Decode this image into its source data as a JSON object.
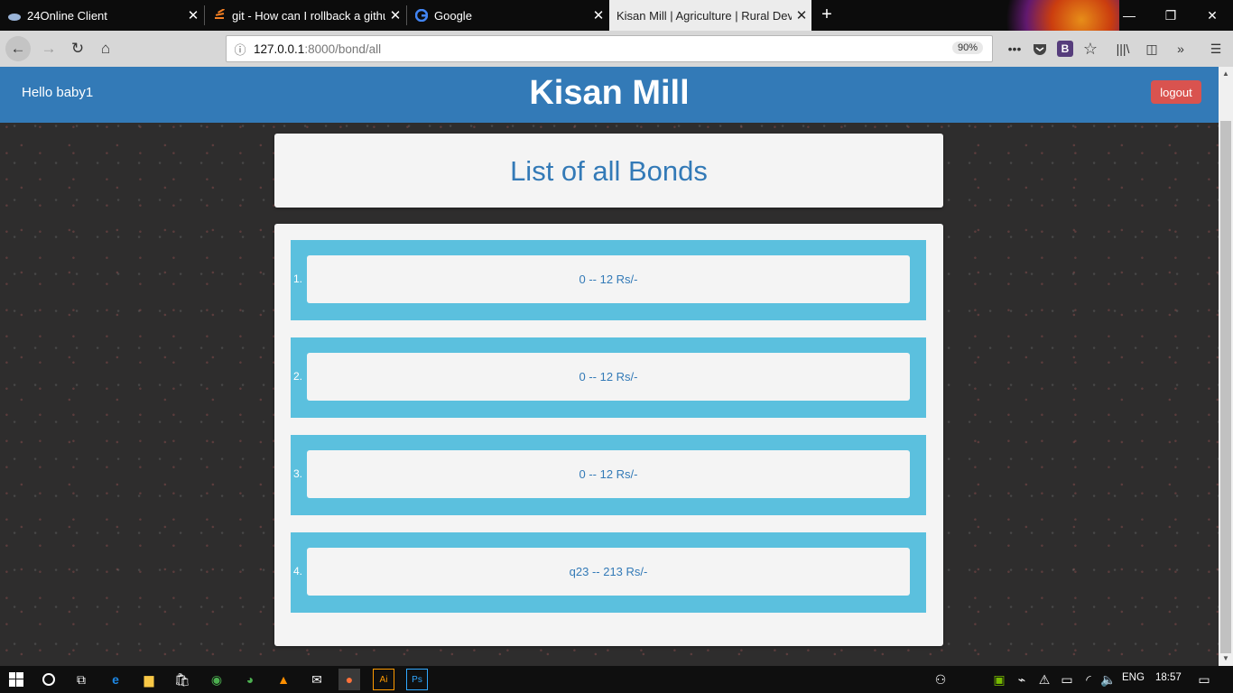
{
  "browser": {
    "tabs": [
      {
        "title": "24Online Client",
        "icon": "cloud-icon"
      },
      {
        "title": "git - How can I rollback a github",
        "icon": "stack-overflow-icon"
      },
      {
        "title": "Google",
        "icon": "google-icon"
      },
      {
        "title": "Kisan Mill | Agriculture | Rural Development",
        "icon": "",
        "active": true
      }
    ],
    "url_host": "127.0.0.1",
    "url_path": ":8000/bond/all",
    "zoom": "90%",
    "toolbar_icons": [
      "more-icon",
      "pocket-icon",
      "bootstrap-extension-icon",
      "bookmark-star-icon",
      "library-icon",
      "sidebar-icon",
      "overflow-icon",
      "menu-icon"
    ]
  },
  "site": {
    "greeting": "Hello baby1",
    "brand": "Kisan Mill",
    "logout_label": "logout",
    "header_color": "#337ab7"
  },
  "page": {
    "title": "List of all Bonds",
    "bonds": [
      {
        "number": "1.",
        "text": "0 -- 12 Rs/-"
      },
      {
        "number": "2.",
        "text": "0 -- 12 Rs/-"
      },
      {
        "number": "3.",
        "text": "0 -- 12 Rs/-"
      },
      {
        "number": "4.",
        "text": "q23 -- 213 Rs/-"
      }
    ],
    "item_color": "#5bc0de"
  },
  "taskbar": {
    "language": "ENG",
    "time": "18:57",
    "apps": [
      "start-icon",
      "cortana-icon",
      "task-view-icon",
      "edge-icon",
      "file-explorer-icon",
      "store-icon",
      "chrome-alt-icon",
      "chrome-icon",
      "vlc-icon",
      "mail-icon",
      "firefox-icon",
      "illustrator-icon",
      "photoshop-icon"
    ]
  }
}
